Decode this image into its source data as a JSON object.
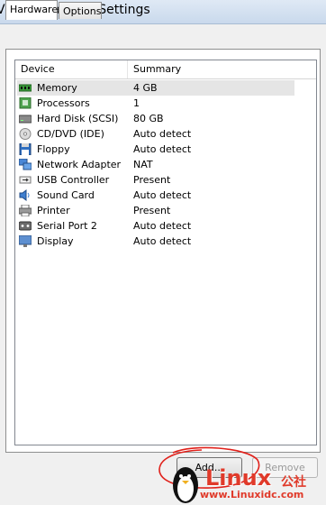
{
  "window": {
    "title": "Virtual Machine Settings"
  },
  "tabs": [
    {
      "label": "Hardware",
      "active": true
    },
    {
      "label": "Options",
      "active": false
    }
  ],
  "device_list": {
    "columns": [
      "Device",
      "Summary"
    ],
    "rows": [
      {
        "device": "Memory",
        "summary": "4 GB",
        "icon": "memory-icon",
        "selected": true
      },
      {
        "device": "Processors",
        "summary": "1",
        "icon": "processor-icon"
      },
      {
        "device": "Hard Disk (SCSI)",
        "summary": "80 GB",
        "icon": "hard-disk-icon"
      },
      {
        "device": "CD/DVD (IDE)",
        "summary": "Auto detect",
        "icon": "cd-dvd-icon"
      },
      {
        "device": "Floppy",
        "summary": "Auto detect",
        "icon": "floppy-icon"
      },
      {
        "device": "Network Adapter",
        "summary": "NAT",
        "icon": "network-adapter-icon"
      },
      {
        "device": "USB Controller",
        "summary": "Present",
        "icon": "usb-icon"
      },
      {
        "device": "Sound Card",
        "summary": "Auto detect",
        "icon": "sound-card-icon"
      },
      {
        "device": "Printer",
        "summary": "Present",
        "icon": "printer-icon"
      },
      {
        "device": "Serial Port 2",
        "summary": "Auto detect",
        "icon": "serial-port-icon"
      },
      {
        "device": "Display",
        "summary": "Auto detect",
        "icon": "display-icon"
      }
    ]
  },
  "buttons": {
    "add": "Add...",
    "remove": "Remove"
  },
  "watermark": {
    "brand": "Linux",
    "brand_cn": "公社",
    "url": "www.Linuxidc.com"
  },
  "colors": {
    "annotation": "#e0201a",
    "watermark": "#e03a2a",
    "selection": "#e5e5e5"
  }
}
